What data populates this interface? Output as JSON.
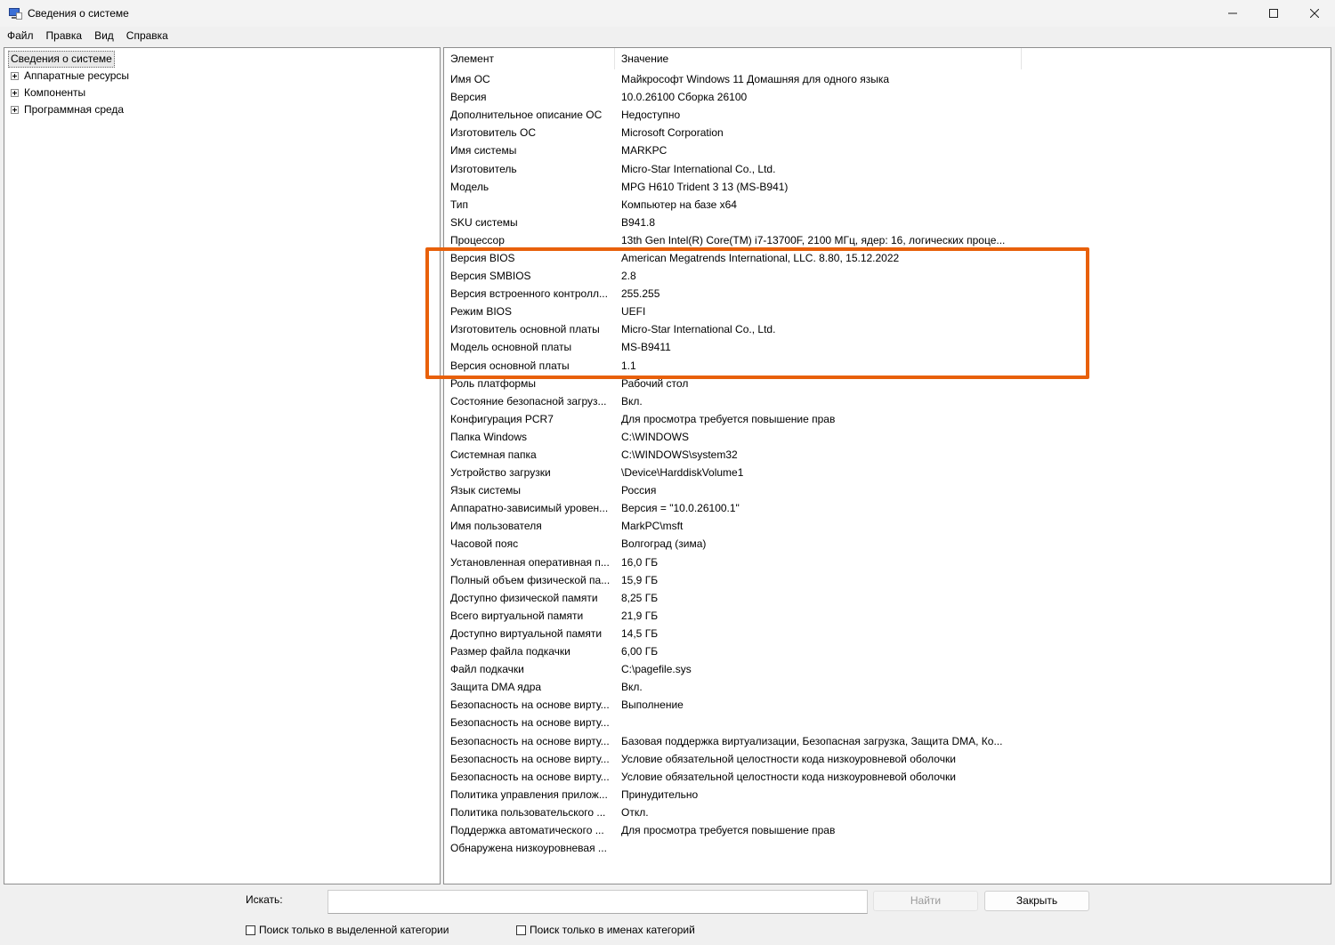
{
  "window": {
    "title": "Сведения о системе",
    "controls": {
      "minimize": "—",
      "maximize": "☐",
      "close": "✕"
    }
  },
  "menu": [
    "Файл",
    "Правка",
    "Вид",
    "Справка"
  ],
  "tree": {
    "root": "Сведения о системе",
    "children": [
      "Аппаратные ресурсы",
      "Компоненты",
      "Программная среда"
    ]
  },
  "list": {
    "columns": [
      "Элемент",
      "Значение"
    ],
    "rows": [
      [
        "Имя ОС",
        "Майкрософт Windows 11 Домашняя для одного языка"
      ],
      [
        "Версия",
        "10.0.26100 Сборка 26100"
      ],
      [
        "Дополнительное описание ОС",
        "Недоступно"
      ],
      [
        "Изготовитель ОС",
        "Microsoft Corporation"
      ],
      [
        "Имя системы",
        "MARKPC"
      ],
      [
        "Изготовитель",
        "Micro-Star International Co., Ltd."
      ],
      [
        "Модель",
        "MPG H610 Trident 3 13 (MS-B941)"
      ],
      [
        "Тип",
        "Компьютер на базе x64"
      ],
      [
        "SKU системы",
        "B941.8"
      ],
      [
        "Процессор",
        "13th Gen Intel(R) Core(TM) i7-13700F, 2100 МГц, ядер: 16, логических проце..."
      ],
      [
        "Версия BIOS",
        "American Megatrends International, LLC. 8.80, 15.12.2022"
      ],
      [
        "Версия SMBIOS",
        "2.8"
      ],
      [
        "Версия встроенного контролл...",
        "255.255"
      ],
      [
        "Режим BIOS",
        "UEFI"
      ],
      [
        "Изготовитель основной платы",
        "Micro-Star International Co., Ltd."
      ],
      [
        "Модель основной платы",
        "MS-B9411"
      ],
      [
        "Версия основной платы",
        "1.1"
      ],
      [
        "Роль платформы",
        "Рабочий стол"
      ],
      [
        "Состояние безопасной загруз...",
        "Вкл."
      ],
      [
        "Конфигурация PCR7",
        "Для просмотра требуется повышение прав"
      ],
      [
        "Папка Windows",
        "C:\\WINDOWS"
      ],
      [
        "Системная папка",
        "C:\\WINDOWS\\system32"
      ],
      [
        "Устройство загрузки",
        "\\Device\\HarddiskVolume1"
      ],
      [
        "Язык системы",
        "Россия"
      ],
      [
        "Аппаратно-зависимый уровен...",
        "Версия = \"10.0.26100.1\""
      ],
      [
        "Имя пользователя",
        "MarkPC\\msft"
      ],
      [
        "Часовой пояс",
        "Волгоград (зима)"
      ],
      [
        "Установленная оперативная п...",
        "16,0 ГБ"
      ],
      [
        "Полный объем физической па...",
        "15,9 ГБ"
      ],
      [
        "Доступно физической памяти",
        "8,25 ГБ"
      ],
      [
        "Всего виртуальной памяти",
        "21,9 ГБ"
      ],
      [
        "Доступно виртуальной памяти",
        "14,5 ГБ"
      ],
      [
        "Размер файла подкачки",
        "6,00 ГБ"
      ],
      [
        "Файл подкачки",
        "C:\\pagefile.sys"
      ],
      [
        "Защита DMA ядра",
        "Вкл."
      ],
      [
        "Безопасность на основе вирту...",
        "Выполнение"
      ],
      [
        "Безопасность на основе вирту...",
        ""
      ],
      [
        "Безопасность на основе вирту...",
        "Базовая поддержка виртуализации, Безопасная загрузка, Защита DMA, Ко..."
      ],
      [
        "Безопасность на основе вирту...",
        "Условие обязательной целостности кода низкоуровневой оболочки"
      ],
      [
        "Безопасность на основе вирту...",
        "Условие обязательной целостности кода низкоуровневой оболочки"
      ],
      [
        "Политика управления прилож...",
        "Принудительно"
      ],
      [
        "Политика пользовательского ...",
        "Откл."
      ],
      [
        "Поддержка автоматического ...",
        "Для просмотра требуется повышение прав"
      ],
      [
        "Обнаружена низкоуровневая ...",
        ""
      ]
    ]
  },
  "search": {
    "label": "Искать:",
    "value": "",
    "find_button": "Найти",
    "close_button": "Закрыть",
    "option_selected_category": "Поиск только в выделенной категории",
    "option_category_names": "Поиск только в именах категорий"
  },
  "colors": {
    "highlight": "#e8600a"
  }
}
